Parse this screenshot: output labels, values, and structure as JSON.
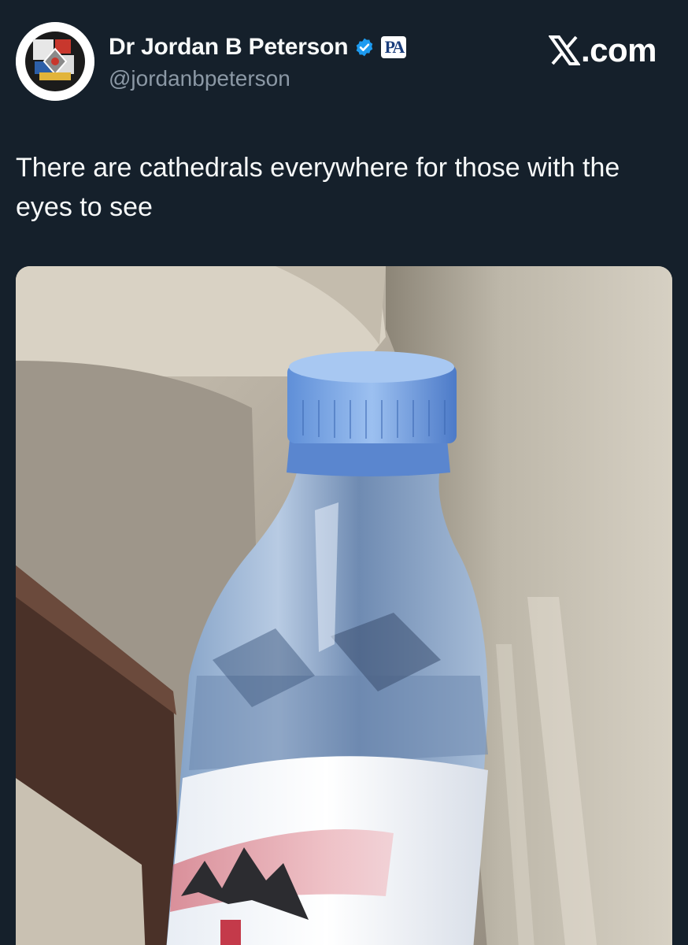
{
  "author": {
    "display_name": "Dr Jordan B Peterson",
    "handle": "@jordanbpeterson",
    "avatar_icon": "avatar-image",
    "verified_icon": "verified-checkmark-icon",
    "verified_color": "#1d9bf0",
    "affiliate_badge": "PA"
  },
  "site": {
    "logo_icon": "x-logo-icon",
    "domain_suffix": ".com"
  },
  "post": {
    "text": "There are cathedrals everywhere for those with the eyes to see"
  },
  "media": {
    "type": "photo",
    "subject": "water-bottle-photo"
  },
  "colors": {
    "background": "#15202b",
    "primary_text": "#f7f9f9",
    "secondary_text": "#8b98a5"
  }
}
